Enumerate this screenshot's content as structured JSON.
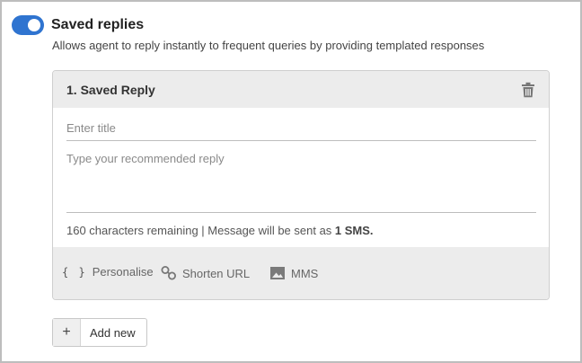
{
  "section": {
    "toggle_on": true,
    "title": "Saved replies",
    "description": "Allows agent to reply instantly to frequent queries by providing templated responses"
  },
  "card": {
    "title": "1. Saved Reply",
    "title_placeholder": "Enter title",
    "reply_placeholder": "Type your recommended reply",
    "counter_text": "160 characters remaining | Message will be sent as ",
    "counter_strong": "1 SMS."
  },
  "toolbar": {
    "personalise_icon": "{ }",
    "personalise": "Personalise",
    "shorten_url": "Shorten URL",
    "mms": "MMS"
  },
  "add_new": {
    "icon": "+",
    "label": "Add new"
  },
  "colors": {
    "accent": "#2f74d0",
    "panel_bg": "#ececec"
  }
}
